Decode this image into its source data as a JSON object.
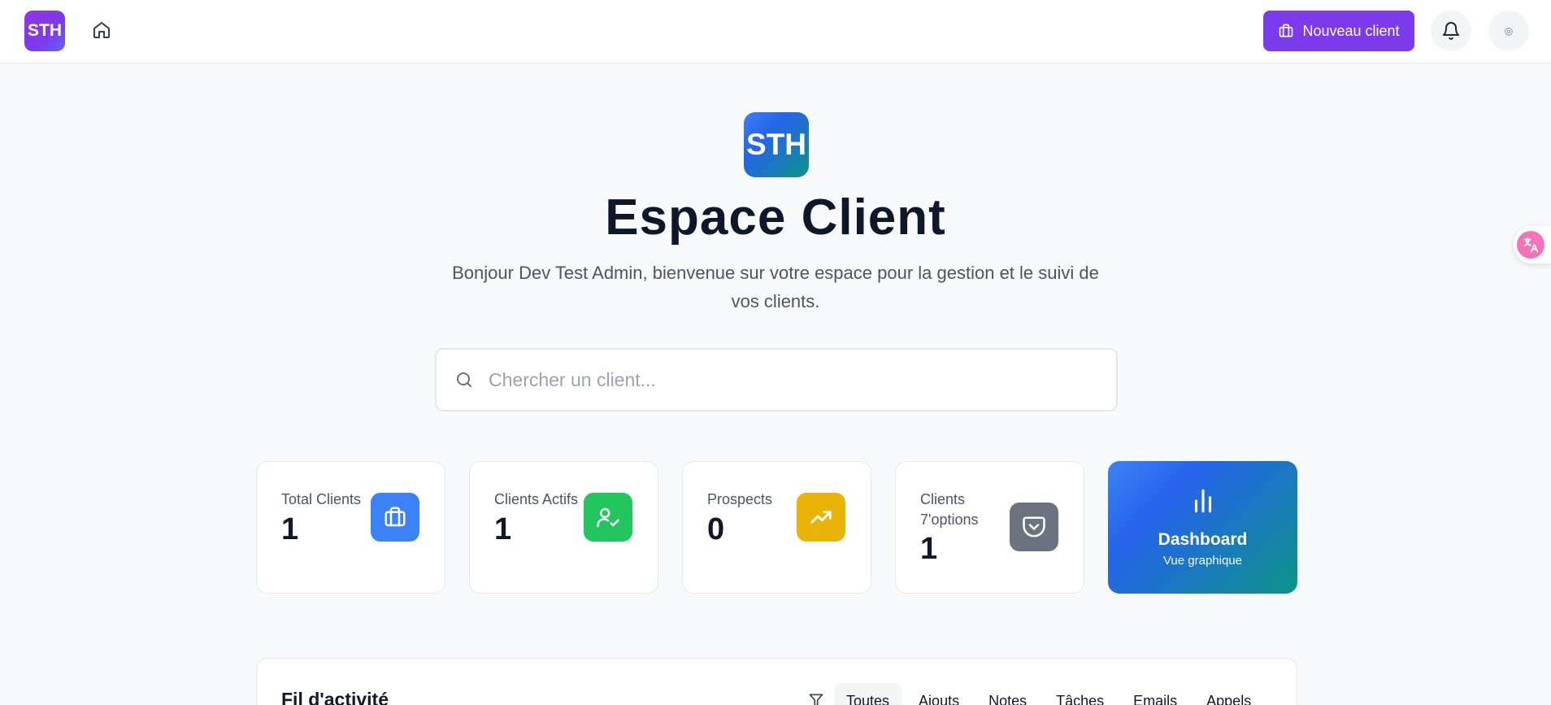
{
  "header": {
    "logo_text": "STH",
    "new_client_label": "Nouveau client",
    "avatar_glyph": "◎"
  },
  "hero": {
    "logo_text": "STH",
    "title": "Espace Client",
    "subtitle": "Bonjour Dev Test Admin, bienvenue sur votre espace pour la gestion et le suivi de vos clients."
  },
  "search": {
    "placeholder": "Chercher un client...",
    "value": ""
  },
  "stats": [
    {
      "label": "Total Clients",
      "value": "1",
      "icon": "briefcase-icon",
      "color": "#3b82f6"
    },
    {
      "label": "Clients Actifs",
      "value": "1",
      "icon": "user-check-icon",
      "color": "#22c55e"
    },
    {
      "label": "Prospects",
      "value": "0",
      "icon": "trending-up-icon",
      "color": "#eab308"
    },
    {
      "label": "Clients 7'options",
      "value": "1",
      "icon": "pocket-icon",
      "color": "#6b7280"
    }
  ],
  "dashboard_card": {
    "title": "Dashboard",
    "subtitle": "Vue graphique"
  },
  "activity": {
    "title": "Fil d'activité",
    "filters": [
      "Toutes",
      "Ajouts",
      "Notes",
      "Tâches",
      "Emails",
      "Appels"
    ],
    "active_filter": "Toutes"
  },
  "colors": {
    "accent": "#7c3aed",
    "background": "#f8f9fb"
  }
}
